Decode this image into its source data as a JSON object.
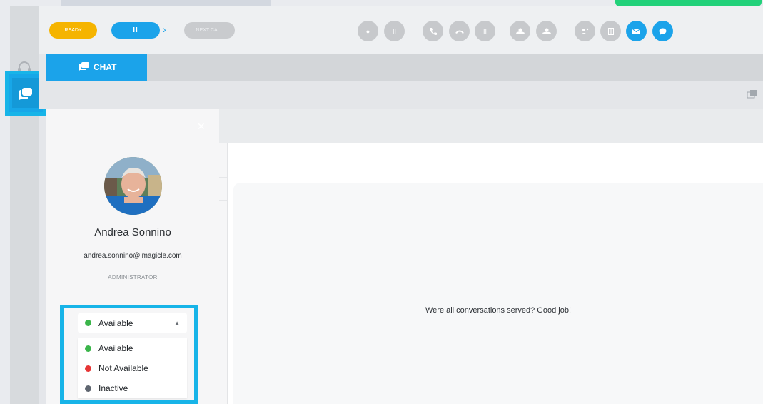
{
  "toolbar": {
    "ready_label": "READY",
    "pause_label": "II",
    "next_call_label": "NEXT CALL"
  },
  "tabs": [
    {
      "label": "CHAT",
      "active": true
    }
  ],
  "profile": {
    "name": "Andrea Sonnino",
    "email": "andrea.sonnino@imagicle.com",
    "role": "ADMINISTRATOR"
  },
  "status": {
    "selected": "Available",
    "selected_color": "#3bb54a",
    "options": [
      {
        "label": "Available",
        "color": "#3bb54a"
      },
      {
        "label": "Not Available",
        "color": "#e63535"
      },
      {
        "label": "Inactive",
        "color": "#5f6670"
      }
    ]
  },
  "main": {
    "empty_message": "Were all conversations served? Good job!"
  },
  "colors": {
    "accent": "#1ba3ea",
    "highlight": "#17b4e8",
    "ready": "#f5b400",
    "disabled": "#c7c9cc"
  }
}
